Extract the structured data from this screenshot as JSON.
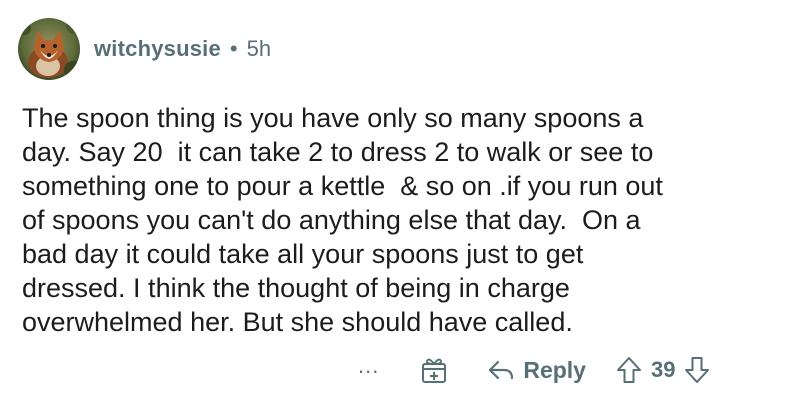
{
  "comment": {
    "author": "witchysusie",
    "separator": "•",
    "age": "5h",
    "text": "The spoon thing is you have only so many spoons a\nday. Say 20  it can take 2 to dress 2 to walk or see to\nsomething one to pour a kettle  & so on .if you run out\nof spoons you can't do anything else that day.  On a\nbad day it could take all your spoons just to get\ndressed. I think the thought of being in charge\noverwhelmed her. But she should have called."
  },
  "actions": {
    "more_label": "...",
    "reply_label": "Reply",
    "score": "39"
  },
  "icons": {
    "avatar": "fox-avatar",
    "more": "more-options-icon",
    "award": "award-gift-icon",
    "reply": "reply-arrow-icon",
    "upvote": "upvote-arrow-icon",
    "downvote": "downvote-arrow-icon"
  },
  "colors": {
    "meta_text": "#576f76",
    "body_text": "#1c1c1c",
    "background": "#ffffff"
  }
}
